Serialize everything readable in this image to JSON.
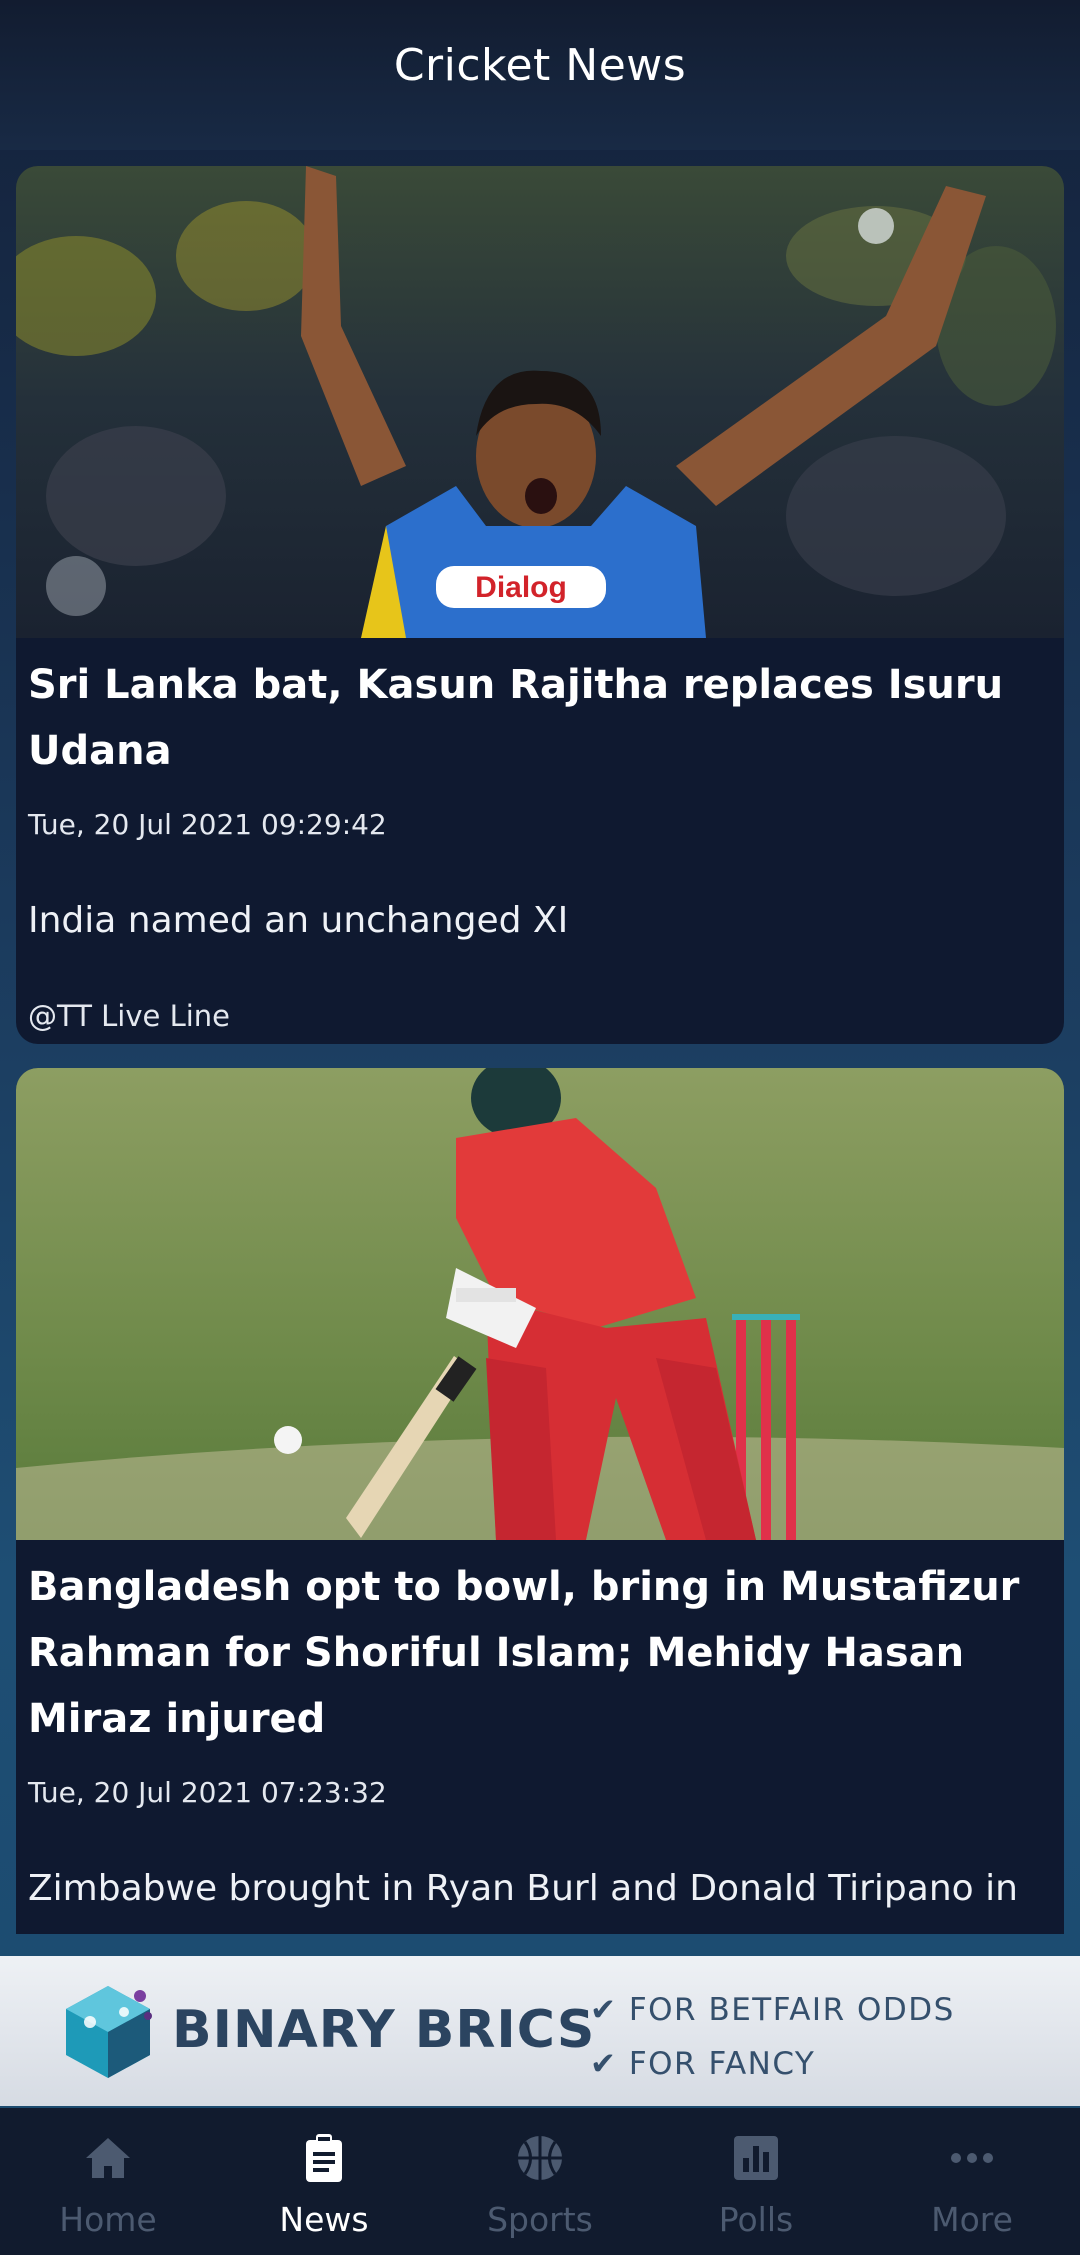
{
  "header": {
    "title": "Cricket News"
  },
  "articles": [
    {
      "title": "Sri Lanka bat, Kasun Rajitha replaces Isuru Udana",
      "date": "Tue, 20 Jul 2021 09:29:42",
      "summary": "India named an unchanged XI",
      "source": "@TT Live Line",
      "jersey_text": "Dialog"
    },
    {
      "title": "Bangladesh opt to bowl, bring in Mustafizur Rahman for Shoriful Islam; Mehidy Hasan Miraz injured",
      "date": "Tue, 20 Jul 2021 07:23:32",
      "summary": "Zimbabwe brought in Ryan Burl and Donald Tiripano in"
    }
  ],
  "ad": {
    "brand": "BINARY BRICS",
    "points": [
      "✔ FOR BETFAIR ODDS",
      "✔ FOR FANCY"
    ]
  },
  "nav": {
    "items": [
      {
        "label": "Home",
        "icon": "home-icon",
        "active": false
      },
      {
        "label": "News",
        "icon": "news-icon",
        "active": true
      },
      {
        "label": "Sports",
        "icon": "sports-icon",
        "active": false
      },
      {
        "label": "Polls",
        "icon": "polls-icon",
        "active": false
      },
      {
        "label": "More",
        "icon": "more-icon",
        "active": false
      }
    ]
  },
  "colors": {
    "card_background": "#0f1930",
    "nav_active": "#ffffff",
    "nav_inactive": "#4c5a70",
    "ad_brand": "#2b4460"
  }
}
